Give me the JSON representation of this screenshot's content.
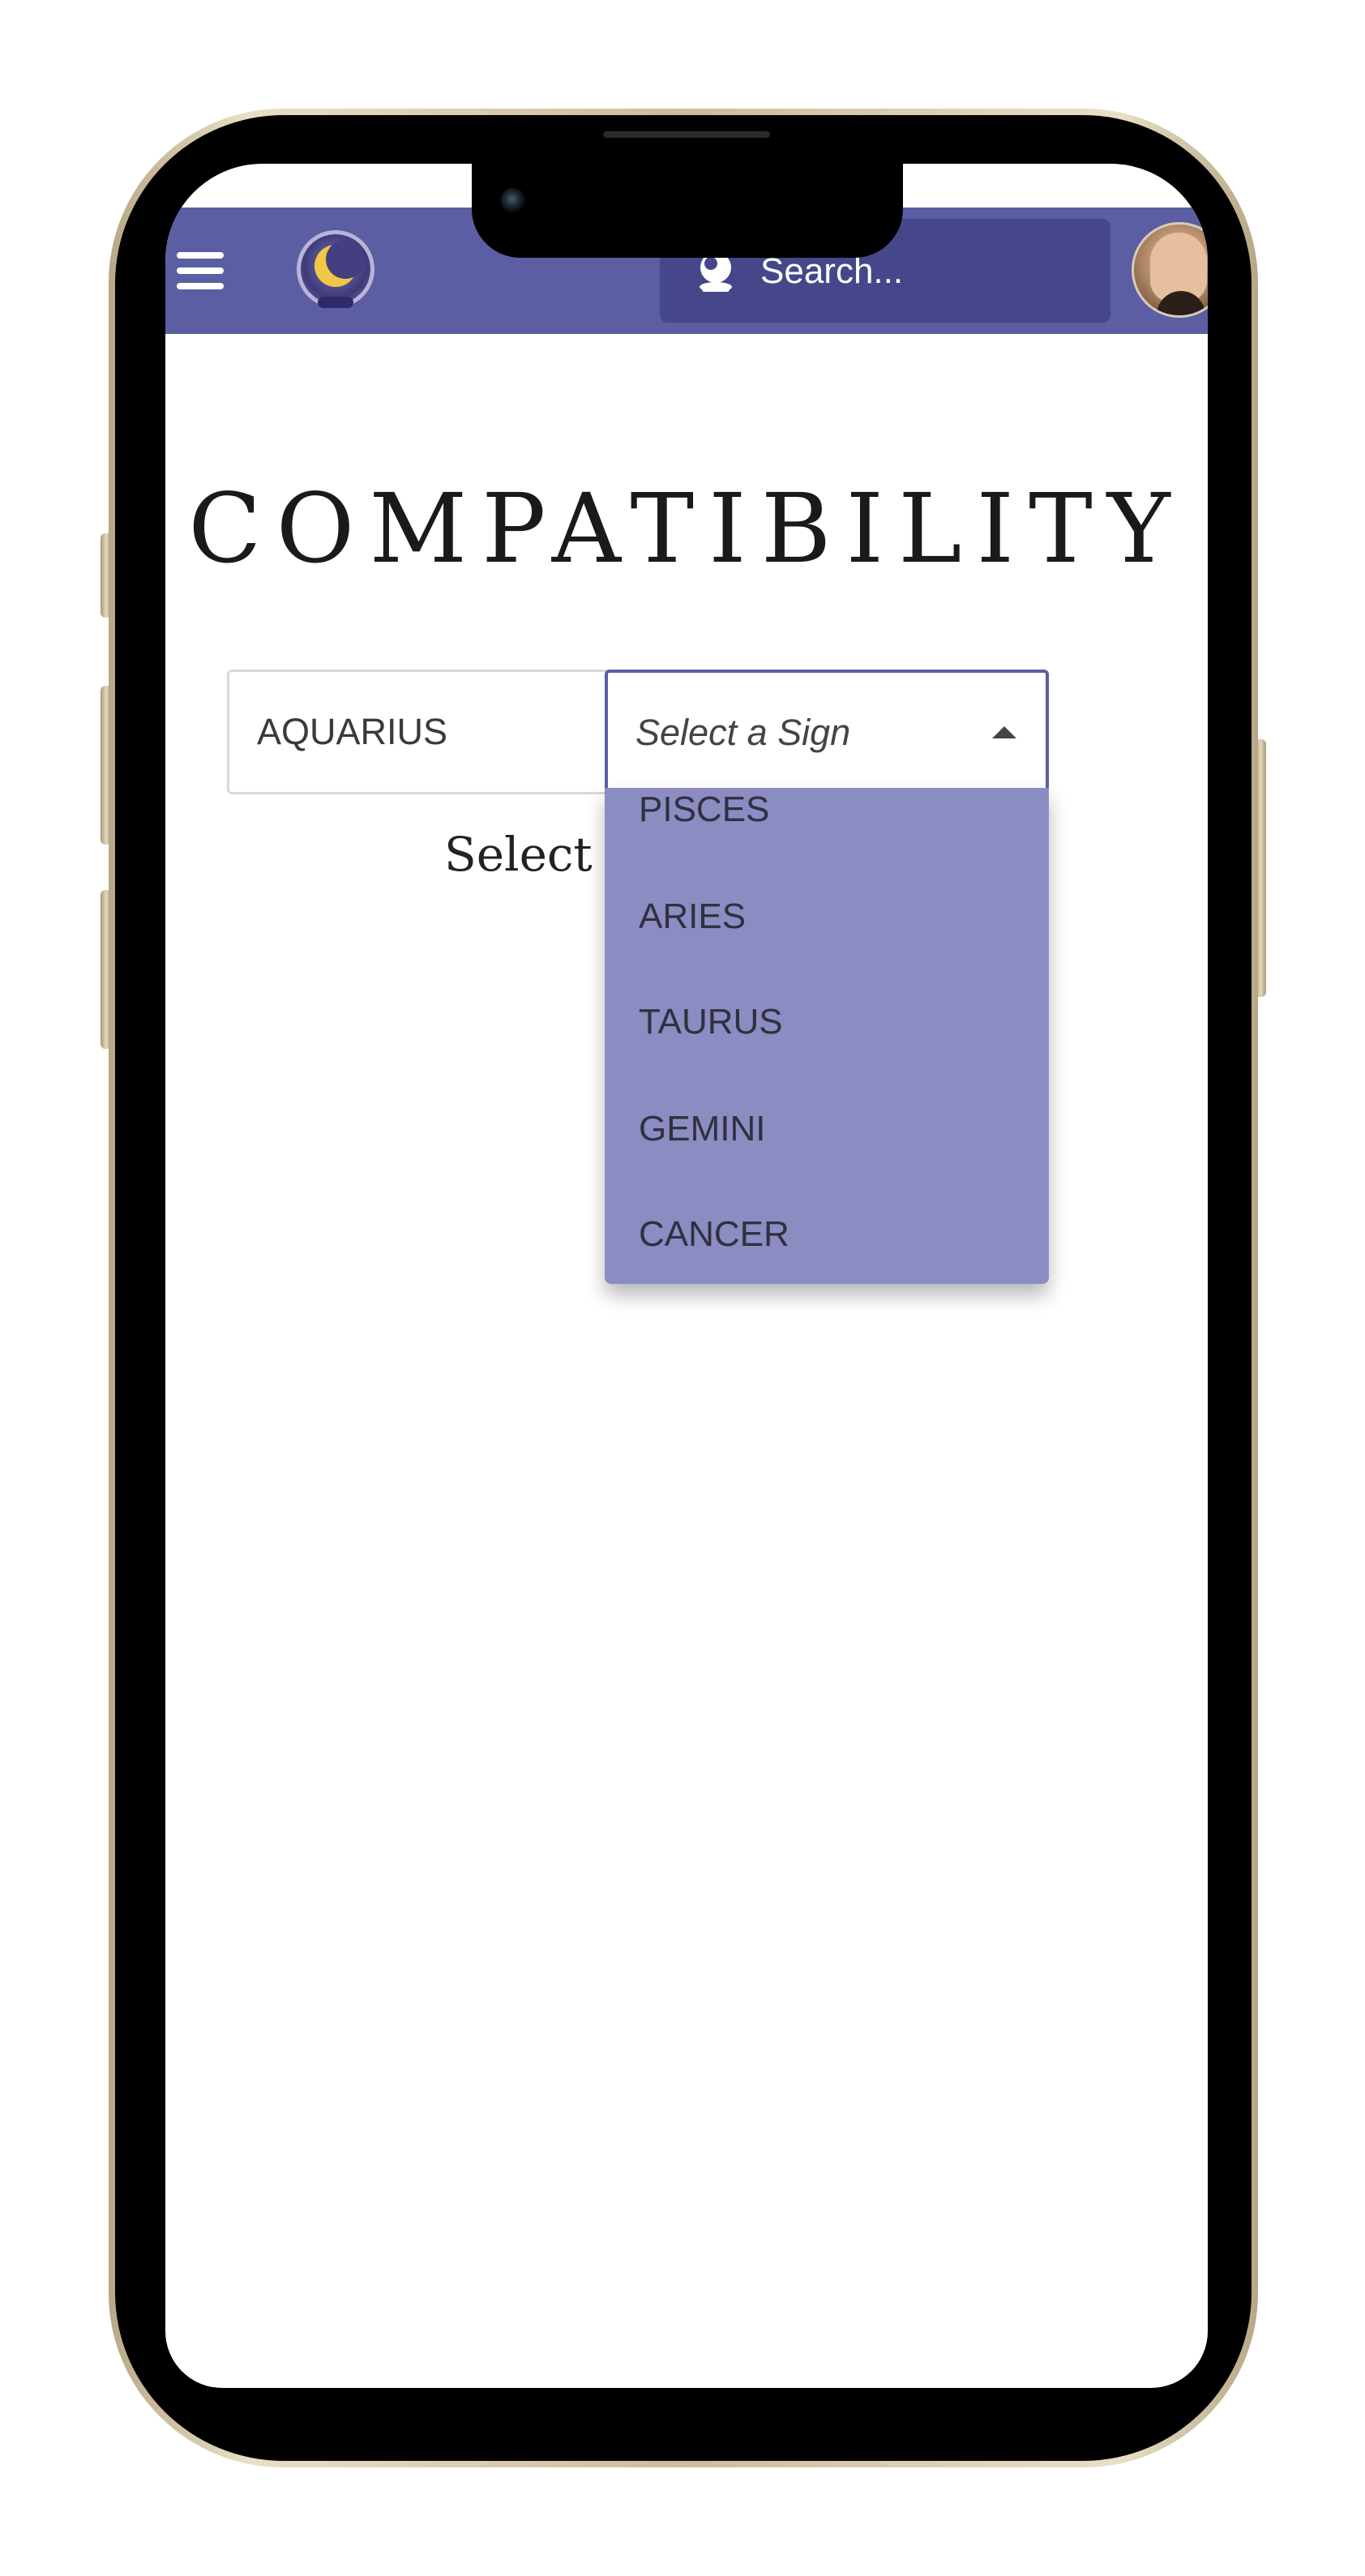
{
  "header": {
    "search_placeholder": "Search..."
  },
  "page": {
    "title": "COMPATIBILITY",
    "hint": "Select one more sign"
  },
  "selects": {
    "first_value": "AQUARIUS",
    "second_placeholder": "Select a Sign"
  },
  "dropdown": {
    "options": [
      "PISCES",
      "ARIES",
      "TAURUS",
      "GEMINI",
      "CANCER"
    ]
  },
  "colors": {
    "brand": "#5c5ea3",
    "search_bg": "#45478a",
    "dropdown_bg": "#8a8cc2"
  },
  "icons": {
    "menu": "menu-icon",
    "logo": "crystal-ball-moon-logo",
    "search": "crystal-ball-icon",
    "avatar": "user-avatar",
    "select_caret_closed": "caret-down-icon",
    "select_caret_open": "caret-up-icon"
  }
}
